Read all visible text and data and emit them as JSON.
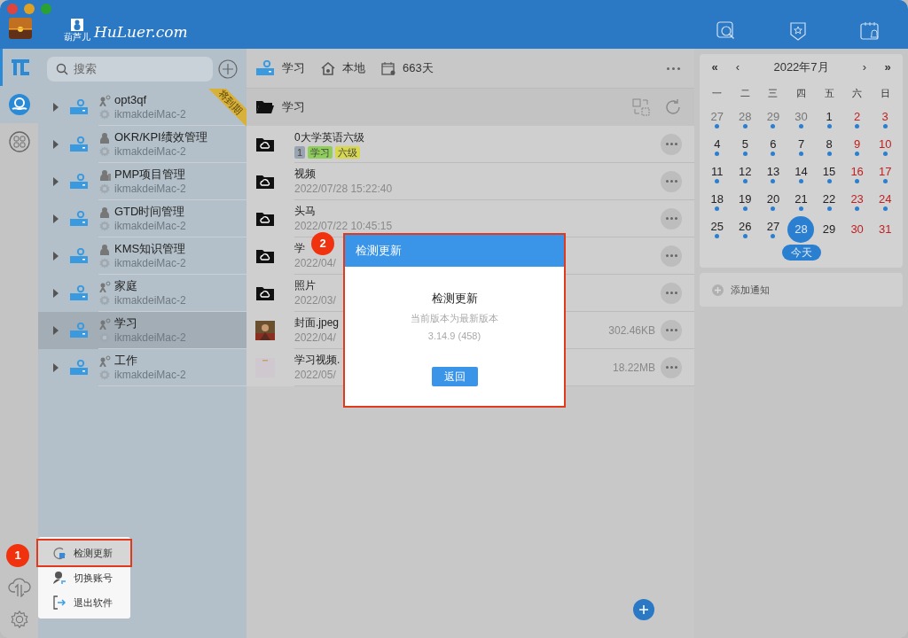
{
  "app": {
    "logo_text": "HuLuer.com",
    "logo_caption": "葫芦儿"
  },
  "rail": [
    {
      "kind": "files",
      "selected": true
    },
    {
      "kind": "person",
      "selected": false
    },
    {
      "kind": "apps",
      "selected": false
    }
  ],
  "search": {
    "placeholder": "搜索"
  },
  "libraries": [
    {
      "name": "opt3qf",
      "kind": "share",
      "device": "ikmakdeiMac-2",
      "ribbon": "将到期",
      "selected": false
    },
    {
      "name": "OKR/KPI绩效管理",
      "kind": "user",
      "device": "ikmakdeiMac-2",
      "selected": false
    },
    {
      "name": "PMP项目管理",
      "kind": "group",
      "device": "ikmakdeiMac-2",
      "selected": false
    },
    {
      "name": "GTD时间管理",
      "kind": "user",
      "device": "ikmakdeiMac-2",
      "selected": false
    },
    {
      "name": "KMS知识管理",
      "kind": "user",
      "device": "ikmakdeiMac-2",
      "selected": false
    },
    {
      "name": "家庭",
      "kind": "share",
      "device": "ikmakdeiMac-2",
      "selected": false
    },
    {
      "name": "学习",
      "kind": "share",
      "device": "ikmakdeiMac-2",
      "selected": true
    },
    {
      "name": "工作",
      "kind": "share",
      "device": "ikmakdeiMac-2",
      "selected": false
    }
  ],
  "menu": [
    {
      "kind": "update",
      "label": "检测更新",
      "selected": true
    },
    {
      "kind": "account",
      "label": "切换账号",
      "selected": false
    },
    {
      "kind": "exit",
      "label": "退出软件",
      "selected": false
    }
  ],
  "toolbar": {
    "library": "学习",
    "location": "本地",
    "days": "663天"
  },
  "path": "学习",
  "files": [
    {
      "kind": "folder",
      "name": "0大学英语六级",
      "tags": [
        {
          "label": "1",
          "color": "#9aa4b0"
        },
        {
          "label": "学习",
          "color": "#8fce5a"
        },
        {
          "label": "六级",
          "color": "#d8d850"
        }
      ]
    },
    {
      "kind": "folder",
      "name": "视频",
      "date": "2022/07/28 15:22:40"
    },
    {
      "kind": "folder",
      "name": "头马",
      "date": "2022/07/22 10:45:15"
    },
    {
      "kind": "folder",
      "name": "学",
      "date": "2022/04/"
    },
    {
      "kind": "folder",
      "name": "照片",
      "date": "2022/03/"
    },
    {
      "name": "封面.jpeg",
      "date": "2022/04/",
      "size": "302.46KB"
    },
    {
      "kind": "video",
      "name": "学习视频.",
      "date": "2022/05/",
      "size": "18.22MB"
    }
  ],
  "calendar": {
    "title": "2022年7月",
    "nav": [
      "«",
      "‹",
      "›",
      "»"
    ],
    "weekdays": [
      "一",
      "二",
      "三",
      "四",
      "五",
      "六",
      "日"
    ],
    "weeks": [
      [
        {
          "day": "27",
          "other": true,
          "weekend": false,
          "dot": true,
          "selected": false
        },
        {
          "day": "28",
          "other": true,
          "weekend": false,
          "dot": true,
          "selected": false
        },
        {
          "day": "29",
          "other": true,
          "weekend": false,
          "dot": true,
          "selected": false
        },
        {
          "day": "30",
          "other": true,
          "weekend": false,
          "dot": true,
          "selected": false
        },
        {
          "day": "1",
          "other": false,
          "weekend": false,
          "dot": true,
          "selected": false
        },
        {
          "day": "2",
          "other": false,
          "weekend": true,
          "dot": true,
          "selected": false
        },
        {
          "day": "3",
          "other": false,
          "weekend": true,
          "dot": true,
          "selected": false
        }
      ],
      [
        {
          "day": "4",
          "other": false,
          "weekend": false,
          "dot": true,
          "selected": false
        },
        {
          "day": "5",
          "other": false,
          "weekend": false,
          "dot": true,
          "selected": false
        },
        {
          "day": "6",
          "other": false,
          "weekend": false,
          "dot": true,
          "selected": false
        },
        {
          "day": "7",
          "other": false,
          "weekend": false,
          "dot": true,
          "selected": false
        },
        {
          "day": "8",
          "other": false,
          "weekend": false,
          "dot": true,
          "selected": false
        },
        {
          "day": "9",
          "other": false,
          "weekend": true,
          "dot": true,
          "selected": false
        },
        {
          "day": "10",
          "other": false,
          "weekend": true,
          "dot": true,
          "selected": false
        }
      ],
      [
        {
          "day": "11",
          "other": false,
          "weekend": false,
          "dot": true,
          "selected": false
        },
        {
          "day": "12",
          "other": false,
          "weekend": false,
          "dot": true,
          "selected": false
        },
        {
          "day": "13",
          "other": false,
          "weekend": false,
          "dot": true,
          "selected": false
        },
        {
          "day": "14",
          "other": false,
          "weekend": false,
          "dot": true,
          "selected": false
        },
        {
          "day": "15",
          "other": false,
          "weekend": false,
          "dot": true,
          "selected": false
        },
        {
          "day": "16",
          "other": false,
          "weekend": true,
          "dot": true,
          "selected": false
        },
        {
          "day": "17",
          "other": false,
          "weekend": true,
          "dot": true,
          "selected": false
        }
      ],
      [
        {
          "day": "18",
          "other": false,
          "weekend": false,
          "dot": true,
          "selected": false
        },
        {
          "day": "19",
          "other": false,
          "weekend": false,
          "dot": true,
          "selected": false
        },
        {
          "day": "20",
          "other": false,
          "weekend": false,
          "dot": true,
          "selected": false
        },
        {
          "day": "21",
          "other": false,
          "weekend": false,
          "dot": true,
          "selected": false
        },
        {
          "day": "22",
          "other": false,
          "weekend": false,
          "dot": true,
          "selected": false
        },
        {
          "day": "23",
          "other": false,
          "weekend": true,
          "dot": true,
          "selected": false
        },
        {
          "day": "24",
          "other": false,
          "weekend": true,
          "dot": true,
          "selected": false
        }
      ],
      [
        {
          "day": "25",
          "other": false,
          "weekend": false,
          "dot": true,
          "selected": false
        },
        {
          "day": "26",
          "other": false,
          "weekend": false,
          "dot": true,
          "selected": false
        },
        {
          "day": "27",
          "other": false,
          "weekend": false,
          "dot": true,
          "selected": false
        },
        {
          "day": "28",
          "other": false,
          "weekend": false,
          "dot": false,
          "selected": true
        },
        {
          "day": "29",
          "other": false,
          "weekend": false,
          "dot": false,
          "selected": false
        },
        {
          "day": "30",
          "other": false,
          "weekend": true,
          "dot": false,
          "selected": false
        },
        {
          "day": "31",
          "other": false,
          "weekend": true,
          "dot": false,
          "selected": false
        }
      ]
    ],
    "today": "今天"
  },
  "notice": {
    "label": "添加通知"
  },
  "dialog": {
    "title": "检测更新",
    "heading": "检测更新",
    "message": "当前版本为最新版本",
    "version": "3.14.9 (458)",
    "button": "返回"
  },
  "markers": [
    "1",
    "2"
  ]
}
